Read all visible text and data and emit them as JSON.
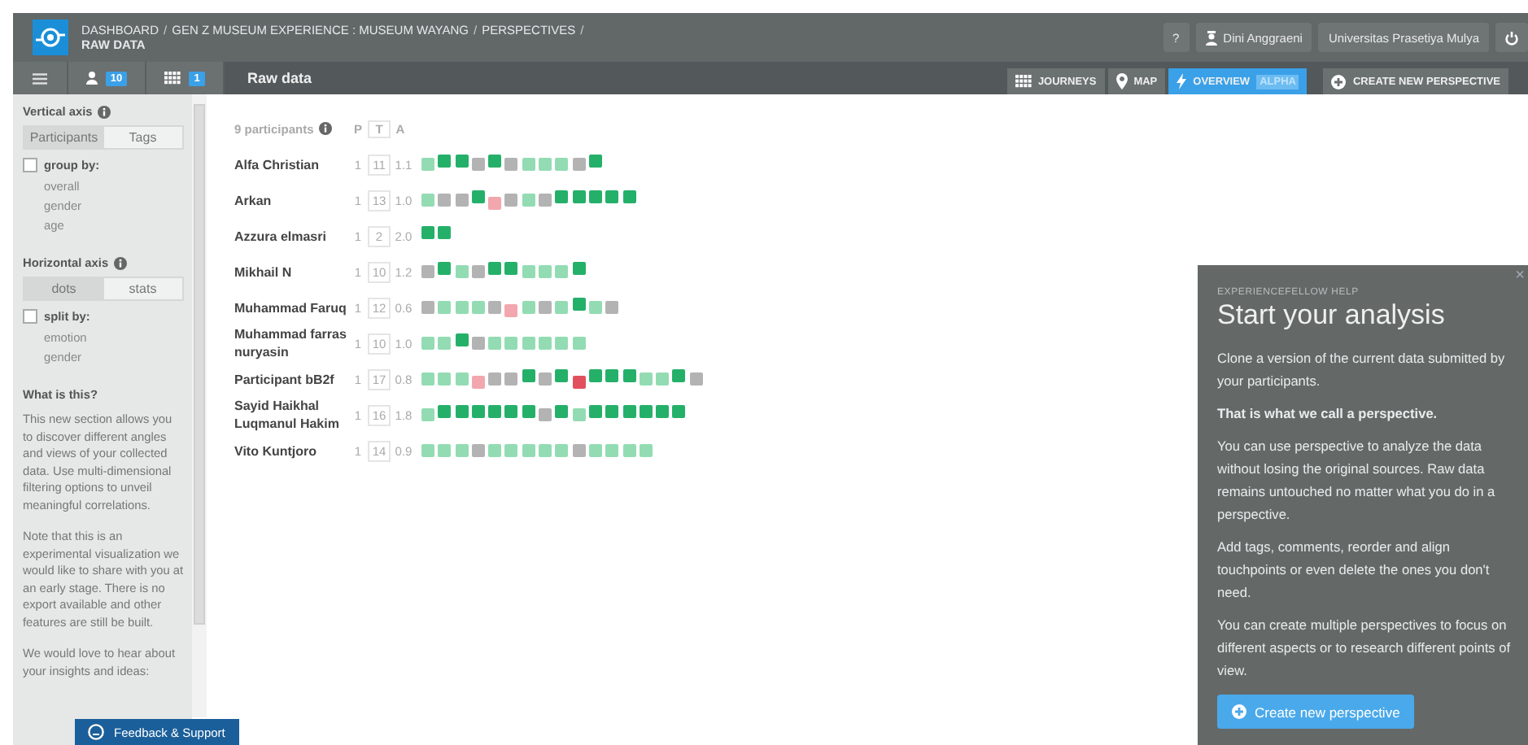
{
  "header": {
    "breadcrumb": [
      {
        "label": "DASHBOARD",
        "separator": "/"
      },
      {
        "label": "GEN Z MUSEUM EXPERIENCE : MUSEUM WAYANG",
        "separator": "/"
      },
      {
        "label": "PERSPECTIVES",
        "separator": "/"
      }
    ],
    "page": "RAW DATA",
    "help": "?",
    "user": "Dini Anggraeni",
    "organization": "Universitas Prasetiya Mulya"
  },
  "toolbar": {
    "participants_badge": "10",
    "journeys_badge": "1",
    "title": "Raw data",
    "views": [
      {
        "label": "JOURNEYS",
        "kind": "grid",
        "selected": false
      },
      {
        "label": "MAP",
        "kind": "pin",
        "selected": false
      },
      {
        "label": "OVERVIEW",
        "badge": "ALPHA",
        "kind": "bolt",
        "selected": true
      }
    ],
    "create_button": "CREATE NEW PERSPECTIVE"
  },
  "sidebar": {
    "sections": [
      {
        "title": "Vertical axis",
        "tabs": [
          {
            "label": "Participants",
            "selected": true
          },
          {
            "label": "Tags",
            "selected": false
          }
        ],
        "option": {
          "label": "group by:",
          "checked": false
        },
        "choices": [
          "overall",
          "gender",
          "age"
        ]
      },
      {
        "title": "Horizontal axis",
        "tabs": [
          {
            "label": "dots",
            "selected": true
          },
          {
            "label": "stats",
            "selected": false
          }
        ],
        "option": {
          "label": "split by:",
          "checked": false
        },
        "choices": [
          "emotion",
          "gender"
        ]
      }
    ],
    "about_title": "What is this?",
    "paragraphs": [
      "This new section allows you to discover different angles and views of your collected data. Use multi-dimensional filtering options to unveil meaningful correlations.",
      "Note that this is an experimental visualization we would like to share with you at an early stage. There is no export available and other features are still be built.",
      "We would love to hear about your insights and ideas:"
    ]
  },
  "participants": {
    "count_label": "9 participants",
    "columns": [
      "P",
      "T",
      "A"
    ],
    "rows": [
      {
        "name": "Alfa Christian",
        "p": "1",
        "t": "11",
        "a": "1.1",
        "dots": [
          {
            "kind": "light"
          },
          {
            "kind": "dark"
          },
          {
            "kind": "dark"
          },
          {
            "kind": "grey"
          },
          {
            "kind": "dark"
          },
          {
            "kind": "grey"
          },
          {
            "kind": "light"
          },
          {
            "kind": "light"
          },
          {
            "kind": "light"
          },
          {
            "kind": "grey"
          },
          {
            "kind": "dark"
          }
        ]
      },
      {
        "name": "Arkan",
        "p": "1",
        "t": "13",
        "a": "1.0",
        "dots": [
          {
            "kind": "light"
          },
          {
            "kind": "grey"
          },
          {
            "kind": "grey"
          },
          {
            "kind": "dark"
          },
          {
            "kind": "pink"
          },
          {
            "kind": "grey"
          },
          {
            "kind": "light"
          },
          {
            "kind": "grey"
          },
          {
            "kind": "dark"
          },
          {
            "kind": "dark"
          },
          {
            "kind": "dark"
          },
          {
            "kind": "dark"
          },
          {
            "kind": "dark"
          }
        ]
      },
      {
        "name": "Azzura elmasri",
        "p": "1",
        "t": "2",
        "a": "2.0",
        "dots": [
          {
            "kind": "dark"
          },
          {
            "kind": "dark"
          }
        ]
      },
      {
        "name": "Mikhail N",
        "p": "1",
        "t": "10",
        "a": "1.2",
        "dots": [
          {
            "kind": "grey"
          },
          {
            "kind": "dark"
          },
          {
            "kind": "light"
          },
          {
            "kind": "grey"
          },
          {
            "kind": "dark"
          },
          {
            "kind": "dark"
          },
          {
            "kind": "light"
          },
          {
            "kind": "light"
          },
          {
            "kind": "light"
          },
          {
            "kind": "dark"
          }
        ]
      },
      {
        "name": "Muhammad Faruq",
        "p": "1",
        "t": "12",
        "a": "0.6",
        "dots": [
          {
            "kind": "grey"
          },
          {
            "kind": "light"
          },
          {
            "kind": "light"
          },
          {
            "kind": "light"
          },
          {
            "kind": "grey"
          },
          {
            "kind": "pink"
          },
          {
            "kind": "light"
          },
          {
            "kind": "grey"
          },
          {
            "kind": "light"
          },
          {
            "kind": "dark"
          },
          {
            "kind": "light"
          },
          {
            "kind": "grey"
          }
        ]
      },
      {
        "name": "Muhammad farras nuryasin",
        "p": "1",
        "t": "10",
        "a": "1.0",
        "dots": [
          {
            "kind": "light"
          },
          {
            "kind": "light"
          },
          {
            "kind": "dark"
          },
          {
            "kind": "grey"
          },
          {
            "kind": "light"
          },
          {
            "kind": "light"
          },
          {
            "kind": "light"
          },
          {
            "kind": "light"
          },
          {
            "kind": "light"
          },
          {
            "kind": "light"
          }
        ]
      },
      {
        "name": "Participant bB2f",
        "p": "1",
        "t": "17",
        "a": "0.8",
        "dots": [
          {
            "kind": "light"
          },
          {
            "kind": "light"
          },
          {
            "kind": "light"
          },
          {
            "kind": "pink"
          },
          {
            "kind": "grey"
          },
          {
            "kind": "grey"
          },
          {
            "kind": "dark"
          },
          {
            "kind": "grey"
          },
          {
            "kind": "dark"
          },
          {
            "kind": "red"
          },
          {
            "kind": "dark"
          },
          {
            "kind": "dark"
          },
          {
            "kind": "dark"
          },
          {
            "kind": "light"
          },
          {
            "kind": "light"
          },
          {
            "kind": "dark"
          },
          {
            "kind": "grey"
          }
        ]
      },
      {
        "name": "Sayid Haikhal Luqmanul Hakim",
        "p": "1",
        "t": "16",
        "a": "1.8",
        "dots": [
          {
            "kind": "light"
          },
          {
            "kind": "dark"
          },
          {
            "kind": "dark"
          },
          {
            "kind": "dark"
          },
          {
            "kind": "dark"
          },
          {
            "kind": "dark"
          },
          {
            "kind": "dark"
          },
          {
            "kind": "grey"
          },
          {
            "kind": "dark"
          },
          {
            "kind": "light"
          },
          {
            "kind": "dark"
          },
          {
            "kind": "dark"
          },
          {
            "kind": "dark"
          },
          {
            "kind": "dark"
          },
          {
            "kind": "dark"
          },
          {
            "kind": "dark"
          }
        ]
      },
      {
        "name": "Vito Kuntjoro",
        "p": "1",
        "t": "14",
        "a": "0.9",
        "dots": [
          {
            "kind": "light"
          },
          {
            "kind": "light"
          },
          {
            "kind": "light"
          },
          {
            "kind": "grey"
          },
          {
            "kind": "light"
          },
          {
            "kind": "light"
          },
          {
            "kind": "light"
          },
          {
            "kind": "light"
          },
          {
            "kind": "light"
          },
          {
            "kind": "grey"
          },
          {
            "kind": "light"
          },
          {
            "kind": "light"
          },
          {
            "kind": "light"
          },
          {
            "kind": "light"
          }
        ]
      }
    ]
  },
  "help_panel": {
    "eyebrow": "EXPERIENCEFELLOW HELP",
    "close": "×",
    "title": "Start your analysis",
    "paragraphs": [
      {
        "text": "Clone a version of the current data submitted by your participants.",
        "bold": false
      },
      {
        "text": "That is what we call a perspective.",
        "bold": true
      },
      {
        "text": "You can use perspective to analyze the data without losing the original sources. Raw data remains untouched no matter what you do in a perspective.",
        "bold": false
      },
      {
        "text": "Add tags, comments, reorder and align touchpoints or even delete the ones you don't need.",
        "bold": false
      },
      {
        "text": "You can create multiple perspectives to focus on different aspects or to research different points of view.",
        "bold": false
      }
    ],
    "button": "Create new perspective"
  },
  "feedback_button": "Feedback & Support"
}
